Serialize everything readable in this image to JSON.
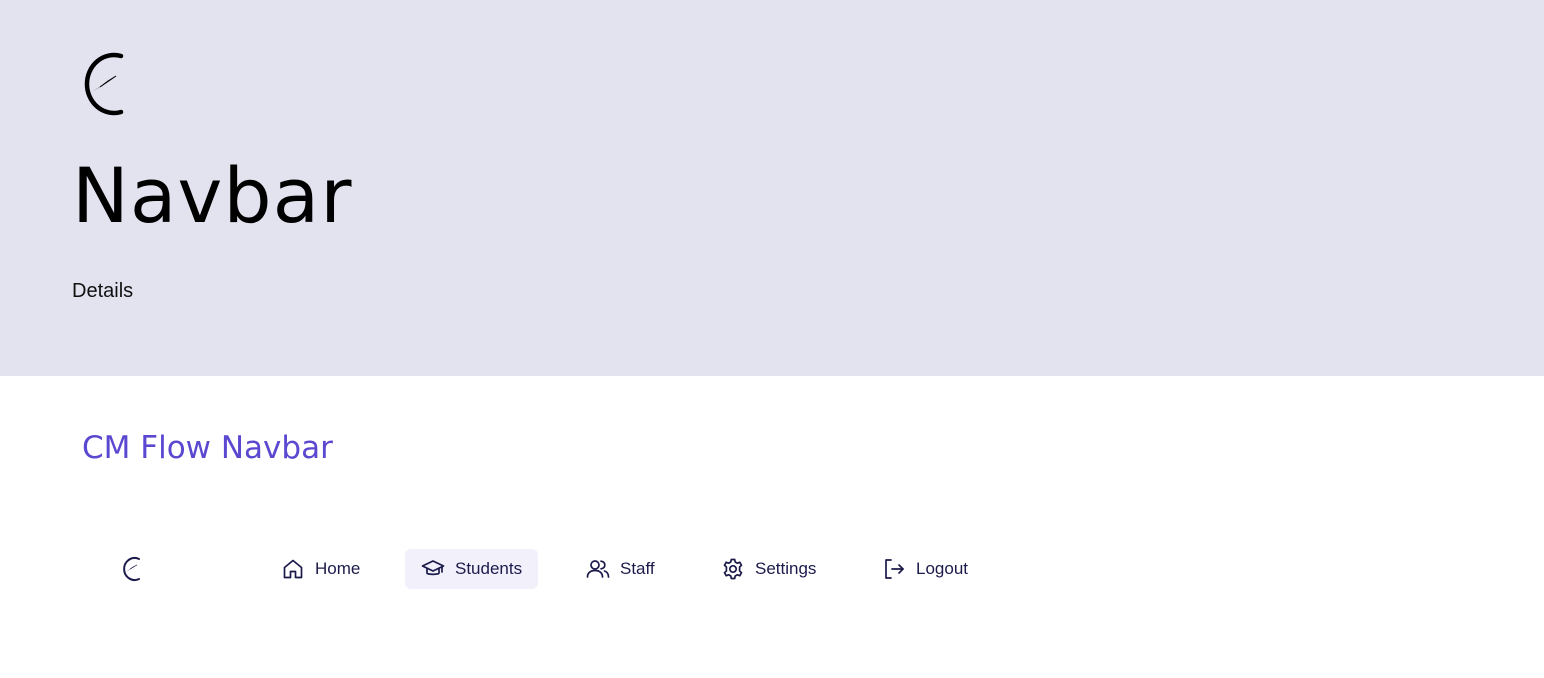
{
  "hero": {
    "logo_icon": "compass-c-logo",
    "title": "Navbar",
    "subtitle": "Details"
  },
  "section": {
    "title": "CM Flow Navbar"
  },
  "navbar": {
    "logo_icon": "compass-c-logo",
    "active_item": "Students",
    "items": [
      {
        "label": "Home",
        "icon": "home-icon"
      },
      {
        "label": "Students",
        "icon": "graduation-cap-icon"
      },
      {
        "label": "Staff",
        "icon": "users-icon"
      },
      {
        "label": "Settings",
        "icon": "gear-icon"
      },
      {
        "label": "Logout",
        "icon": "logout-icon"
      }
    ]
  },
  "colors": {
    "hero_background": "#e3e3f0",
    "accent": "#5b48d0",
    "nav_text": "#1b1a4a",
    "active_background": "#f1f0fb"
  }
}
